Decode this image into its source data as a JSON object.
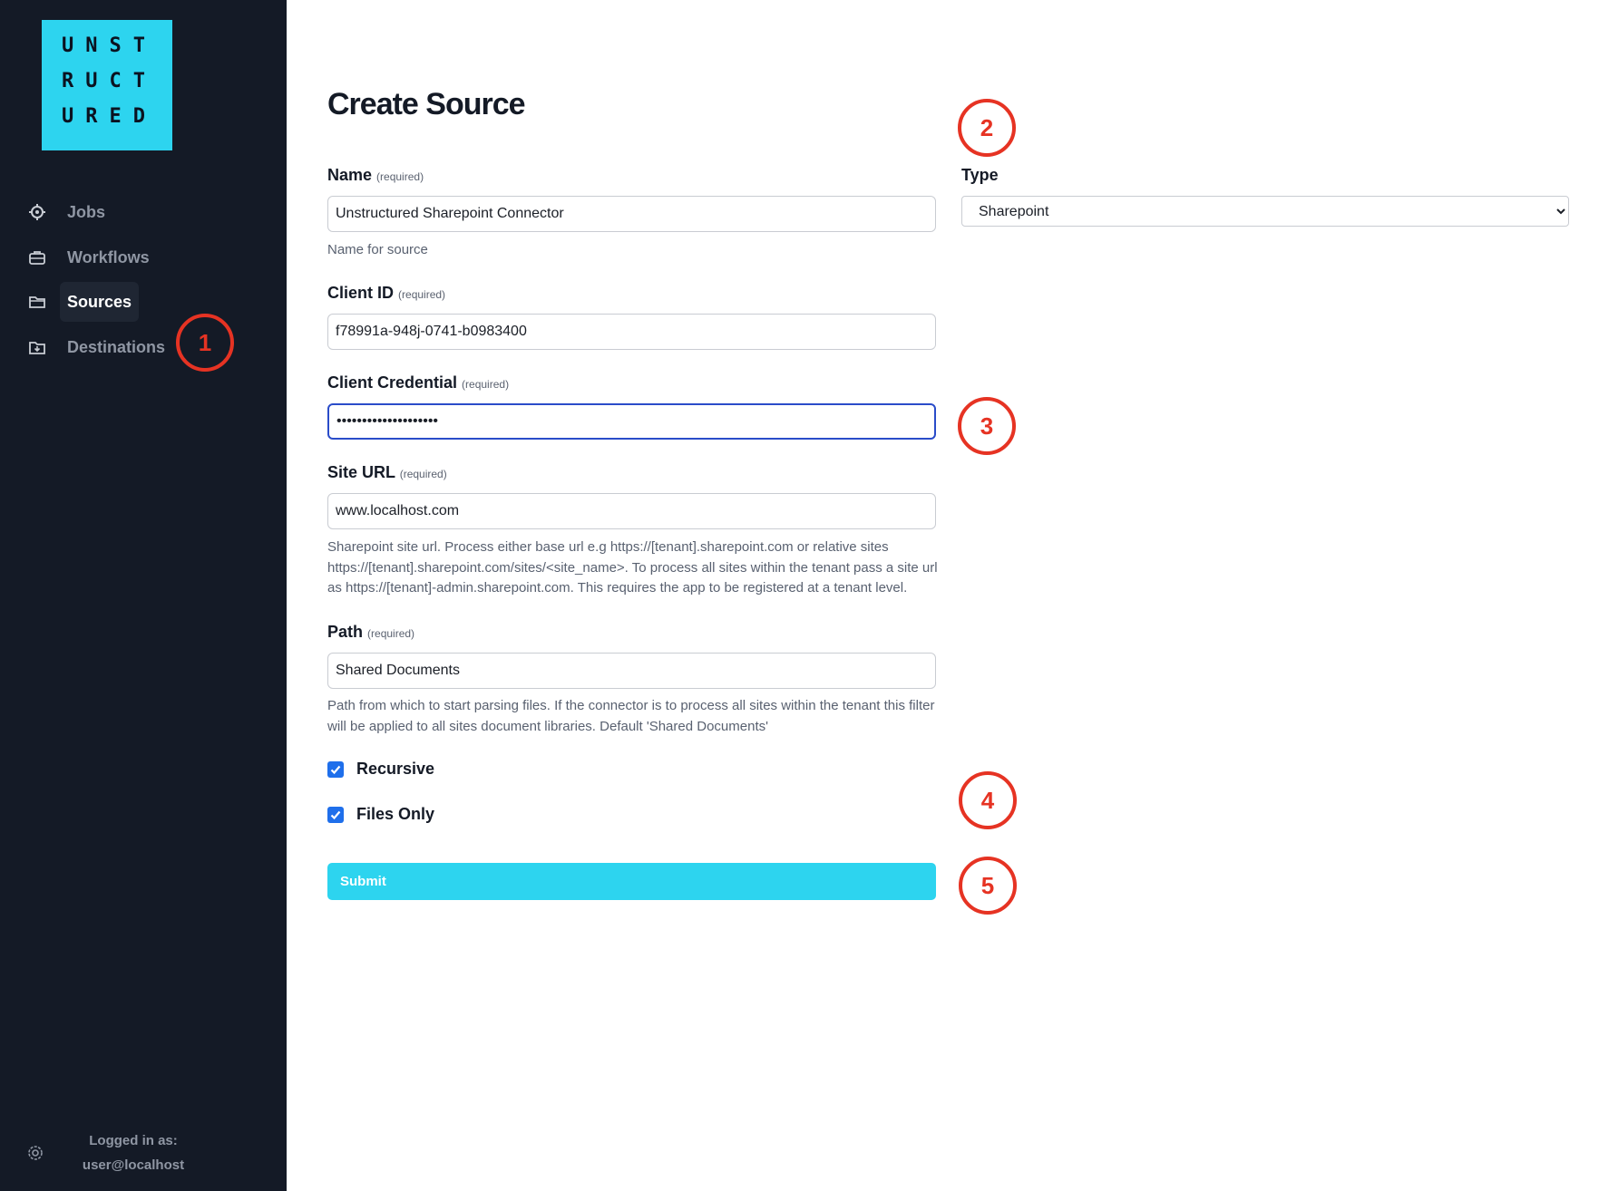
{
  "logo": {
    "rows": [
      "UNST",
      "RUCT",
      "URED"
    ]
  },
  "sidebar": {
    "items": [
      {
        "label": "Jobs",
        "icon": "gear-icon",
        "active": false
      },
      {
        "label": "Workflows",
        "icon": "briefcase-icon",
        "active": false
      },
      {
        "label": "Sources",
        "icon": "folder-icon",
        "active": true
      },
      {
        "label": "Destinations",
        "icon": "folder-download-icon",
        "active": false
      }
    ],
    "footer": {
      "line1": "Logged in as:",
      "line2": "user@localhost",
      "icon": "settings-icon"
    }
  },
  "page": {
    "title": "Create Source"
  },
  "form": {
    "required_tag": "(required)",
    "name": {
      "label": "Name",
      "value": "Unstructured Sharepoint Connector",
      "help": "Name for source"
    },
    "type": {
      "label": "Type",
      "value": "Sharepoint"
    },
    "client_id": {
      "label": "Client ID",
      "value": "f78991a-948j-0741-b0983400"
    },
    "client_credential": {
      "label": "Client Credential",
      "value": "••••••••••••••••••••"
    },
    "site_url": {
      "label": "Site URL",
      "value": "www.localhost.com",
      "help": "Sharepoint site url. Process either base url e.g https://[tenant].sharepoint.com or relative sites https://[tenant].sharepoint.com/sites/<site_name>. To process all sites within the tenant pass a site url as https://[tenant]-admin.sharepoint.com. This requires the app to be registered at a tenant level."
    },
    "path": {
      "label": "Path",
      "value": "Shared Documents",
      "help": "Path from which to start parsing files. If the connector is to process all sites within the tenant this filter will be applied to all sites document libraries. Default 'Shared Documents'"
    },
    "recursive": {
      "label": "Recursive",
      "checked": true
    },
    "files_only": {
      "label": "Files Only",
      "checked": true
    },
    "submit_label": "Submit"
  },
  "annotations": [
    "1",
    "2",
    "3",
    "4",
    "5"
  ],
  "colors": {
    "sidebar_bg": "#141a26",
    "accent": "#2dd4ef",
    "marker": "#e63323",
    "checkbox": "#1f6feb",
    "focus": "#2a4cc9"
  }
}
